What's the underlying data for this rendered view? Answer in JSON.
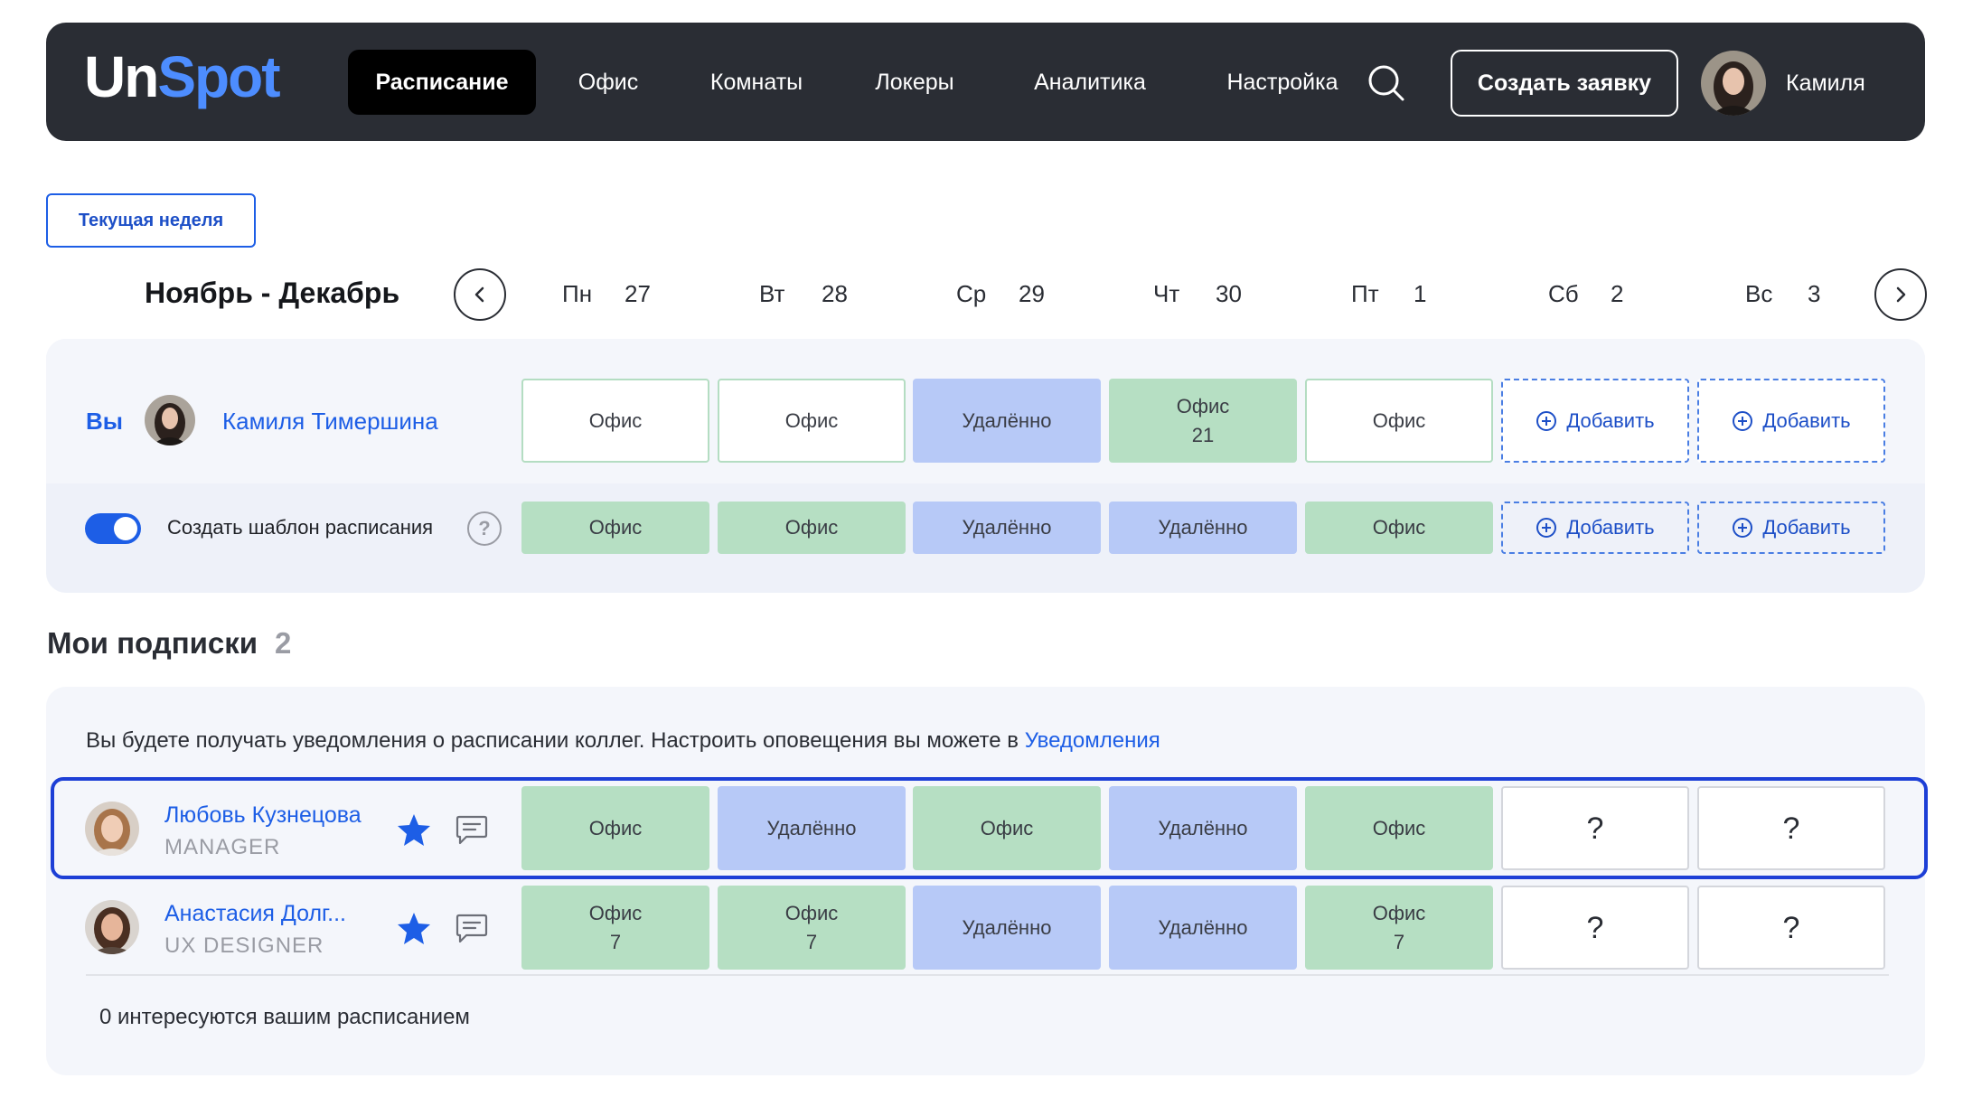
{
  "app": {
    "logo_part1": "Un",
    "logo_part2": "Spot"
  },
  "nav": {
    "items": [
      "Расписание",
      "Офис",
      "Комнаты",
      "Локеры",
      "Аналитика",
      "Настройка"
    ],
    "active_index": 0,
    "search_icon": "search-icon",
    "create_button": "Создать заявку",
    "user_name": "Камиля"
  },
  "week": {
    "current_week_button": "Текущая неделя",
    "range_title": "Ноябрь - Декабрь",
    "prev_icon": "chevron-left-icon",
    "next_icon": "chevron-right-icon",
    "days": [
      {
        "name": "Пн",
        "num": "27"
      },
      {
        "name": "Вт",
        "num": "28"
      },
      {
        "name": "Ср",
        "num": "29"
      },
      {
        "name": "Чт",
        "num": "30"
      },
      {
        "name": "Пт",
        "num": "1"
      },
      {
        "name": "Сб",
        "num": "2"
      },
      {
        "name": "Вс",
        "num": "3"
      }
    ]
  },
  "my_schedule": {
    "you_label": "Вы",
    "name": "Камиля Тимершина",
    "cells": [
      {
        "label": "Офис",
        "kind": "outline"
      },
      {
        "label": "Офис",
        "kind": "outline"
      },
      {
        "label": "Удалённо",
        "kind": "remote"
      },
      {
        "label": "Офис",
        "sub": "21",
        "kind": "office"
      },
      {
        "label": "Офис",
        "kind": "outline"
      },
      {
        "label": "Добавить",
        "kind": "add"
      },
      {
        "label": "Добавить",
        "kind": "add"
      }
    ]
  },
  "template": {
    "toggle_on": true,
    "label": "Создать шаблон расписания",
    "help": "?",
    "cells": [
      {
        "label": "Офис",
        "kind": "office"
      },
      {
        "label": "Офис",
        "kind": "office"
      },
      {
        "label": "Удалённо",
        "kind": "remote"
      },
      {
        "label": "Удалённо",
        "kind": "remote"
      },
      {
        "label": "Офис",
        "kind": "office"
      },
      {
        "label": "Добавить",
        "kind": "add"
      },
      {
        "label": "Добавить",
        "kind": "add"
      }
    ]
  },
  "subscriptions": {
    "title": "Мои подписки",
    "count": "2",
    "notice_text": "Вы будете получать уведомления о расписании коллег. Настроить оповещения вы можете в ",
    "notice_link": "Уведомления",
    "people": [
      {
        "name": "Любовь Кузнецова",
        "role": "MANAGER",
        "favorite": true,
        "cells": [
          {
            "label": "Офис",
            "kind": "office"
          },
          {
            "label": "Удалённо",
            "kind": "remote"
          },
          {
            "label": "Офис",
            "kind": "office"
          },
          {
            "label": "Удалённо",
            "kind": "remote"
          },
          {
            "label": "Офис",
            "kind": "office"
          },
          {
            "label": "?",
            "kind": "unknown"
          },
          {
            "label": "?",
            "kind": "unknown"
          }
        ]
      },
      {
        "name": "Анастасия Долг...",
        "role": "UX DESIGNER",
        "favorite": true,
        "cells": [
          {
            "label": "Офис",
            "sub": "7",
            "kind": "office"
          },
          {
            "label": "Офис",
            "sub": "7",
            "kind": "office"
          },
          {
            "label": "Удалённо",
            "kind": "remote"
          },
          {
            "label": "Удалённо",
            "kind": "remote"
          },
          {
            "label": "Офис",
            "sub": "7",
            "kind": "office"
          },
          {
            "label": "?",
            "kind": "unknown"
          },
          {
            "label": "?",
            "kind": "unknown"
          }
        ]
      }
    ],
    "interest_text": "0 интересуются вашим расписанием"
  },
  "colors": {
    "topbar": "#2a2d34",
    "accent": "#1d5ee6",
    "office": "#b6dfc3",
    "remote": "#b7c9f7"
  }
}
